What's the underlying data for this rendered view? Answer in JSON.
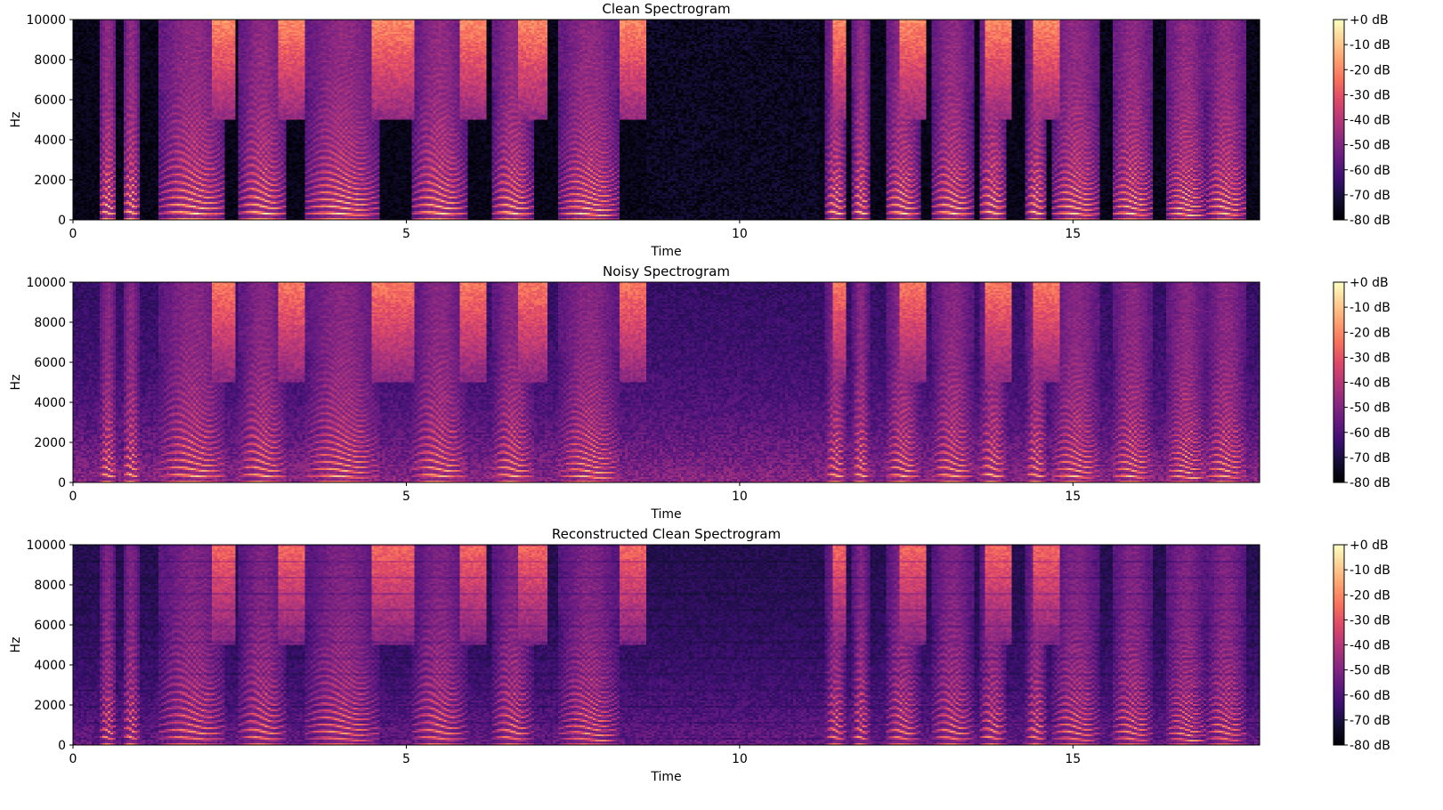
{
  "chart_data": [
    {
      "type": "heatmap",
      "title": "Clean Spectrogram",
      "xlabel": "Time",
      "ylabel": "Hz",
      "xlim": [
        0,
        17.8
      ],
      "ylim": [
        0,
        10000
      ],
      "xticks": [
        0,
        5,
        10,
        15
      ],
      "yticks": [
        0,
        2000,
        4000,
        6000,
        8000,
        10000
      ],
      "colorbar": {
        "range": [
          -80,
          0
        ],
        "ticks": [
          "+0 dB",
          "-10 dB",
          "-20 dB",
          "-30 dB",
          "-40 dB",
          "-50 dB",
          "-60 dB",
          "-70 dB",
          "-80 dB"
        ]
      },
      "colormap": "magma",
      "noise_floor": 0.0
    },
    {
      "type": "heatmap",
      "title": "Noisy Spectrogram",
      "xlabel": "Time",
      "ylabel": "Hz",
      "xlim": [
        0,
        17.8
      ],
      "ylim": [
        0,
        10000
      ],
      "xticks": [
        0,
        5,
        10,
        15
      ],
      "yticks": [
        0,
        2000,
        4000,
        6000,
        8000,
        10000
      ],
      "colorbar": {
        "range": [
          -80,
          0
        ],
        "ticks": [
          "+0 dB",
          "-10 dB",
          "-20 dB",
          "-30 dB",
          "-40 dB",
          "-50 dB",
          "-60 dB",
          "-70 dB",
          "-80 dB"
        ]
      },
      "colormap": "magma",
      "noise_floor": 0.45
    },
    {
      "type": "heatmap",
      "title": "Reconstructed Clean Spectrogram",
      "xlabel": "Time",
      "ylabel": "Hz",
      "xlim": [
        0,
        17.8
      ],
      "ylim": [
        0,
        10000
      ],
      "xticks": [
        0,
        5,
        10,
        15
      ],
      "yticks": [
        0,
        2000,
        4000,
        6000,
        8000,
        10000
      ],
      "colorbar": {
        "range": [
          -80,
          0
        ],
        "ticks": [
          "+0 dB",
          "-10 dB",
          "-20 dB",
          "-30 dB",
          "-40 dB",
          "-50 dB",
          "-60 dB",
          "-70 dB",
          "-80 dB"
        ]
      },
      "colormap": "magma",
      "noise_floor": 0.35
    }
  ],
  "speech_segments": [
    {
      "start": 0.4,
      "end": 0.65,
      "f0": 350
    },
    {
      "start": 0.75,
      "end": 1.0,
      "f0": 380
    },
    {
      "start": 1.3,
      "end": 2.3,
      "f0": 330
    },
    {
      "start": 2.5,
      "end": 3.2,
      "f0": 340
    },
    {
      "start": 3.5,
      "end": 4.6,
      "f0": 300
    },
    {
      "start": 5.1,
      "end": 5.9,
      "f0": 330
    },
    {
      "start": 6.3,
      "end": 6.9,
      "f0": 330
    },
    {
      "start": 7.3,
      "end": 8.2,
      "f0": 280
    },
    {
      "start": 11.3,
      "end": 11.6,
      "f0": 360
    },
    {
      "start": 11.7,
      "end": 11.95,
      "f0": 360
    },
    {
      "start": 12.2,
      "end": 12.7,
      "f0": 330
    },
    {
      "start": 12.9,
      "end": 13.5,
      "f0": 330
    },
    {
      "start": 13.6,
      "end": 14.0,
      "f0": 360
    },
    {
      "start": 14.3,
      "end": 14.6,
      "f0": 360
    },
    {
      "start": 14.7,
      "end": 15.4,
      "f0": 300
    },
    {
      "start": 15.6,
      "end": 16.2,
      "f0": 300
    },
    {
      "start": 16.4,
      "end": 17.0,
      "f0": 260
    },
    {
      "start": 17.0,
      "end": 17.6,
      "f0": 300
    }
  ],
  "fricative_segments": [
    {
      "start": 2.1,
      "end": 2.45
    },
    {
      "start": 3.1,
      "end": 3.5
    },
    {
      "start": 4.5,
      "end": 5.1
    },
    {
      "start": 5.8,
      "end": 6.2
    },
    {
      "start": 6.7,
      "end": 7.1
    },
    {
      "start": 8.2,
      "end": 8.6
    },
    {
      "start": 11.4,
      "end": 11.6
    },
    {
      "start": 12.4,
      "end": 12.8
    },
    {
      "start": 13.7,
      "end": 14.1
    },
    {
      "start": 14.4,
      "end": 14.8
    }
  ],
  "colormap_stops": [
    "#000004",
    "#140e36",
    "#3b0f70",
    "#641a80",
    "#8c2981",
    "#b73779",
    "#de4968",
    "#f7705c",
    "#fe9f6d",
    "#fecf92",
    "#fcfdbf"
  ]
}
